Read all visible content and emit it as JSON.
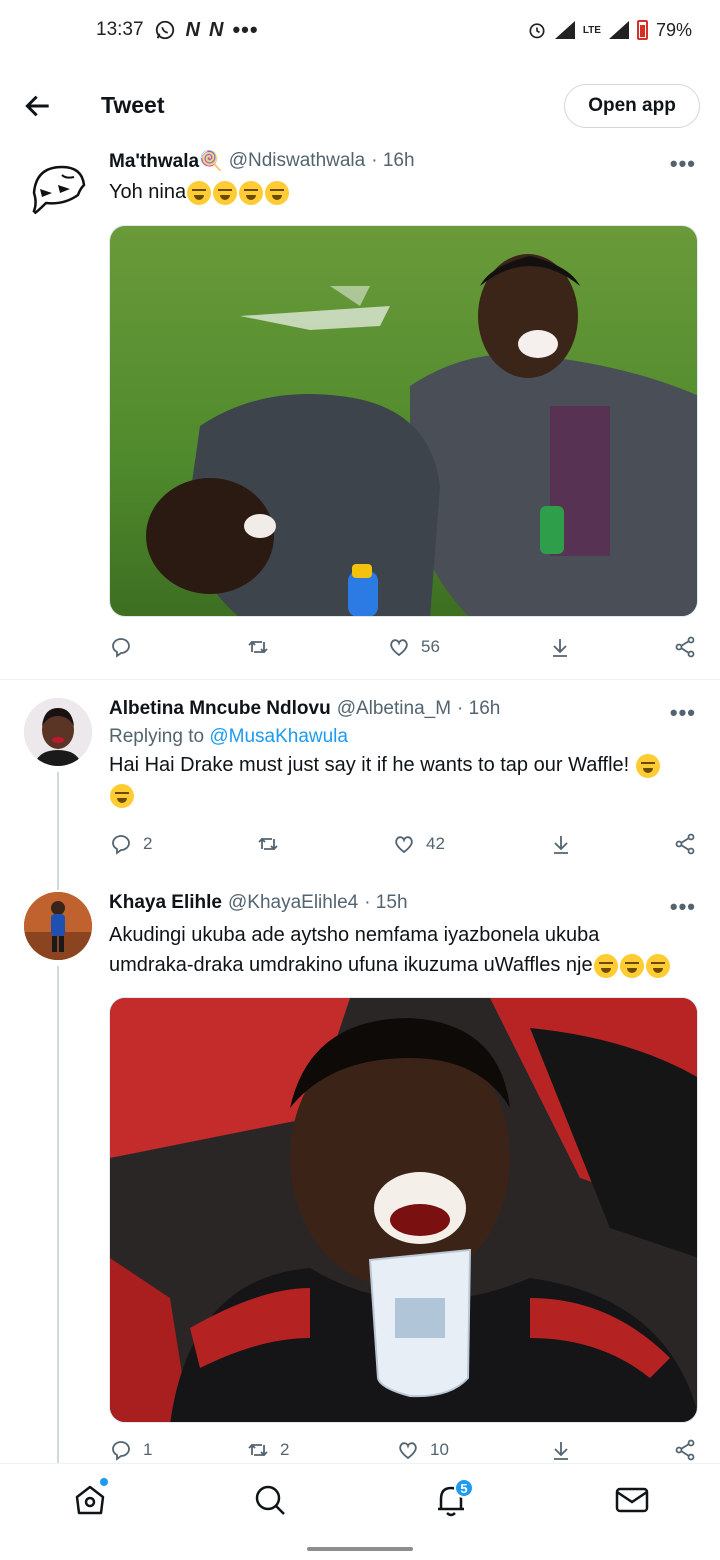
{
  "status_bar": {
    "time": "13:37",
    "notification_icons": [
      "whatsapp-icon",
      "netflix-icon",
      "netflix-icon",
      "more-dots-icon"
    ],
    "network": "LTE",
    "battery": "79%"
  },
  "header": {
    "title": "Tweet",
    "open_app_label": "Open app"
  },
  "tweets": [
    {
      "name": "Ma'thwala🍭",
      "handle": "@Ndiswathwala",
      "time": "· 16h",
      "text": "Yoh nina",
      "emojis": [
        "😭",
        "😭",
        "😭",
        "😂"
      ],
      "has_media": true,
      "actions": {
        "replies": "",
        "retweets": "",
        "likes": "56"
      }
    },
    {
      "name": "Albetina Mncube Ndlovu",
      "handle": "@Albetina_M",
      "time": "· 16h",
      "replying_prefix": "Replying to",
      "replying_to": "@MusaKhawula",
      "text": "Hai Hai Drake must just say it if he wants to tap our Waffle!",
      "emojis": [
        "😩",
        "😌"
      ],
      "has_media": false,
      "actions": {
        "replies": "2",
        "retweets": "",
        "likes": "42"
      }
    },
    {
      "name": "Khaya Elihle",
      "handle": "@KhayaElihle4",
      "time": "· 15h",
      "text_line1": "Akudingi ukuba ade aytsho nemfama iyazbonela ukuba",
      "text_line2": "umdraka-draka umdrakino ufuna ikuzuma uWaffles nje",
      "emojis": [
        "😂",
        "😂",
        "😂"
      ],
      "has_media": true,
      "actions": {
        "replies": "1",
        "retweets": "2",
        "likes": "10"
      }
    }
  ],
  "bottom_nav": {
    "items": [
      "home-icon",
      "search-icon",
      "notifications-icon",
      "messages-icon"
    ],
    "notification_count": "5"
  },
  "colors": {
    "accent": "#1d9bf0",
    "text_primary": "#0f1419",
    "text_secondary": "#536471"
  }
}
